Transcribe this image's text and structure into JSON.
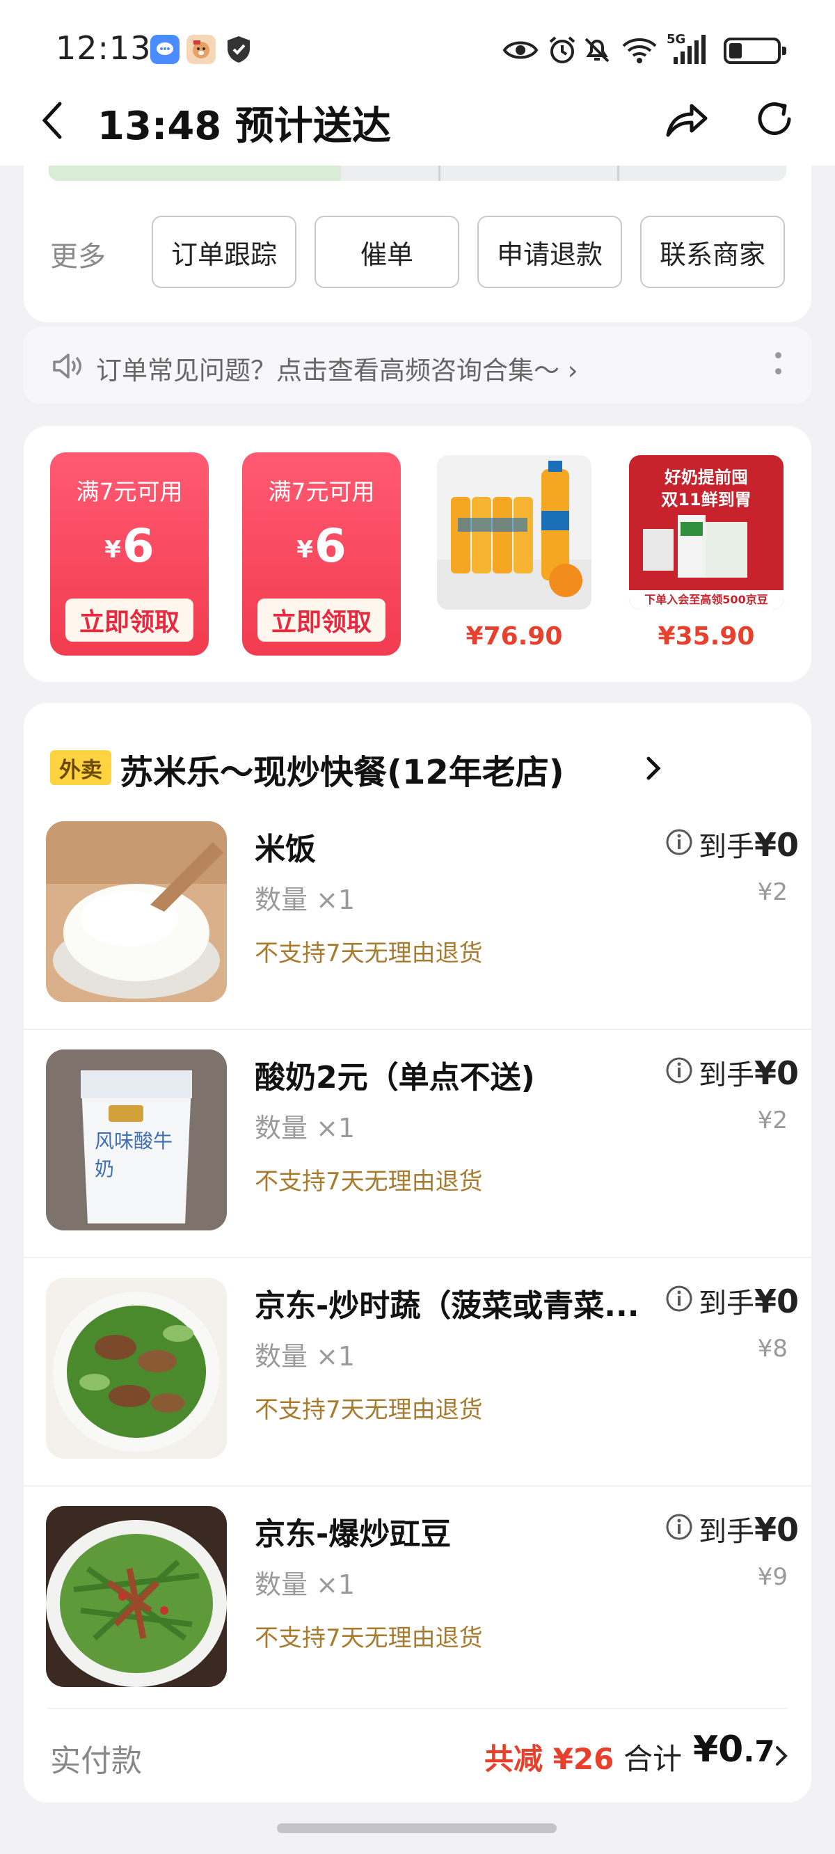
{
  "status_bar": {
    "time": "12:13",
    "network": "5G"
  },
  "header": {
    "title": "13:48 预计送达"
  },
  "actions": {
    "more_label": "更多",
    "buttons": [
      "订单跟踪",
      "催单",
      "申请退款",
      "联系商家"
    ]
  },
  "faq": {
    "text": "订单常见问题？点击查看高频咨询合集～ ›"
  },
  "promos": {
    "coupons": [
      {
        "condition": "满7元可用",
        "currency": "¥",
        "amount": "6",
        "button": "立即领取"
      },
      {
        "condition": "满7元可用",
        "currency": "¥",
        "amount": "6",
        "button": "立即领取"
      }
    ],
    "products": [
      {
        "price": "¥76.90",
        "image": "orange-juice-bottles"
      },
      {
        "price": "¥35.90",
        "image": "milk-promo-banner",
        "banner_title": "好奶提前囤",
        "banner_sub": "双11鲜到胃",
        "banner_foot": "下单入会至高领500京豆"
      }
    ]
  },
  "store": {
    "tag": "外卖",
    "name": "苏米乐～现炒快餐(12年老店)",
    "items": [
      {
        "name": "米饭",
        "qty": "数量 ×1",
        "policy": "不支持7天无理由退货",
        "got_label": "到手",
        "got_value": "¥0",
        "orig_price": "¥2",
        "image": "rice-bowl"
      },
      {
        "name": "酸奶2元（单点不送)",
        "qty": "数量 ×1",
        "policy": "不支持7天无理由退货",
        "got_label": "到手",
        "got_value": "¥0",
        "orig_price": "¥2",
        "image": "yogurt-cup",
        "image_text": "风味酸牛奶"
      },
      {
        "name": "京东-炒时蔬（菠菜或青菜...",
        "qty": "数量 ×1",
        "policy": "不支持7天无理由退货",
        "got_label": "到手",
        "got_value": "¥0",
        "orig_price": "¥8",
        "image": "stir-fried-greens"
      },
      {
        "name": "京东-爆炒豇豆",
        "qty": "数量 ×1",
        "policy": "不支持7天无理由退货",
        "got_label": "到手",
        "got_value": "¥0",
        "orig_price": "¥9",
        "image": "fried-long-beans"
      }
    ]
  },
  "summary": {
    "paid_label": "实付款",
    "discount": "共减 ¥26",
    "total_label": "合计",
    "total_main": "¥0",
    "total_dec": ".7"
  },
  "colors": {
    "accent_red": "#e8402c",
    "coupon_red": "#f23b4f",
    "tag_yellow": "#ffd23f",
    "policy_brown": "#a87a2c"
  }
}
